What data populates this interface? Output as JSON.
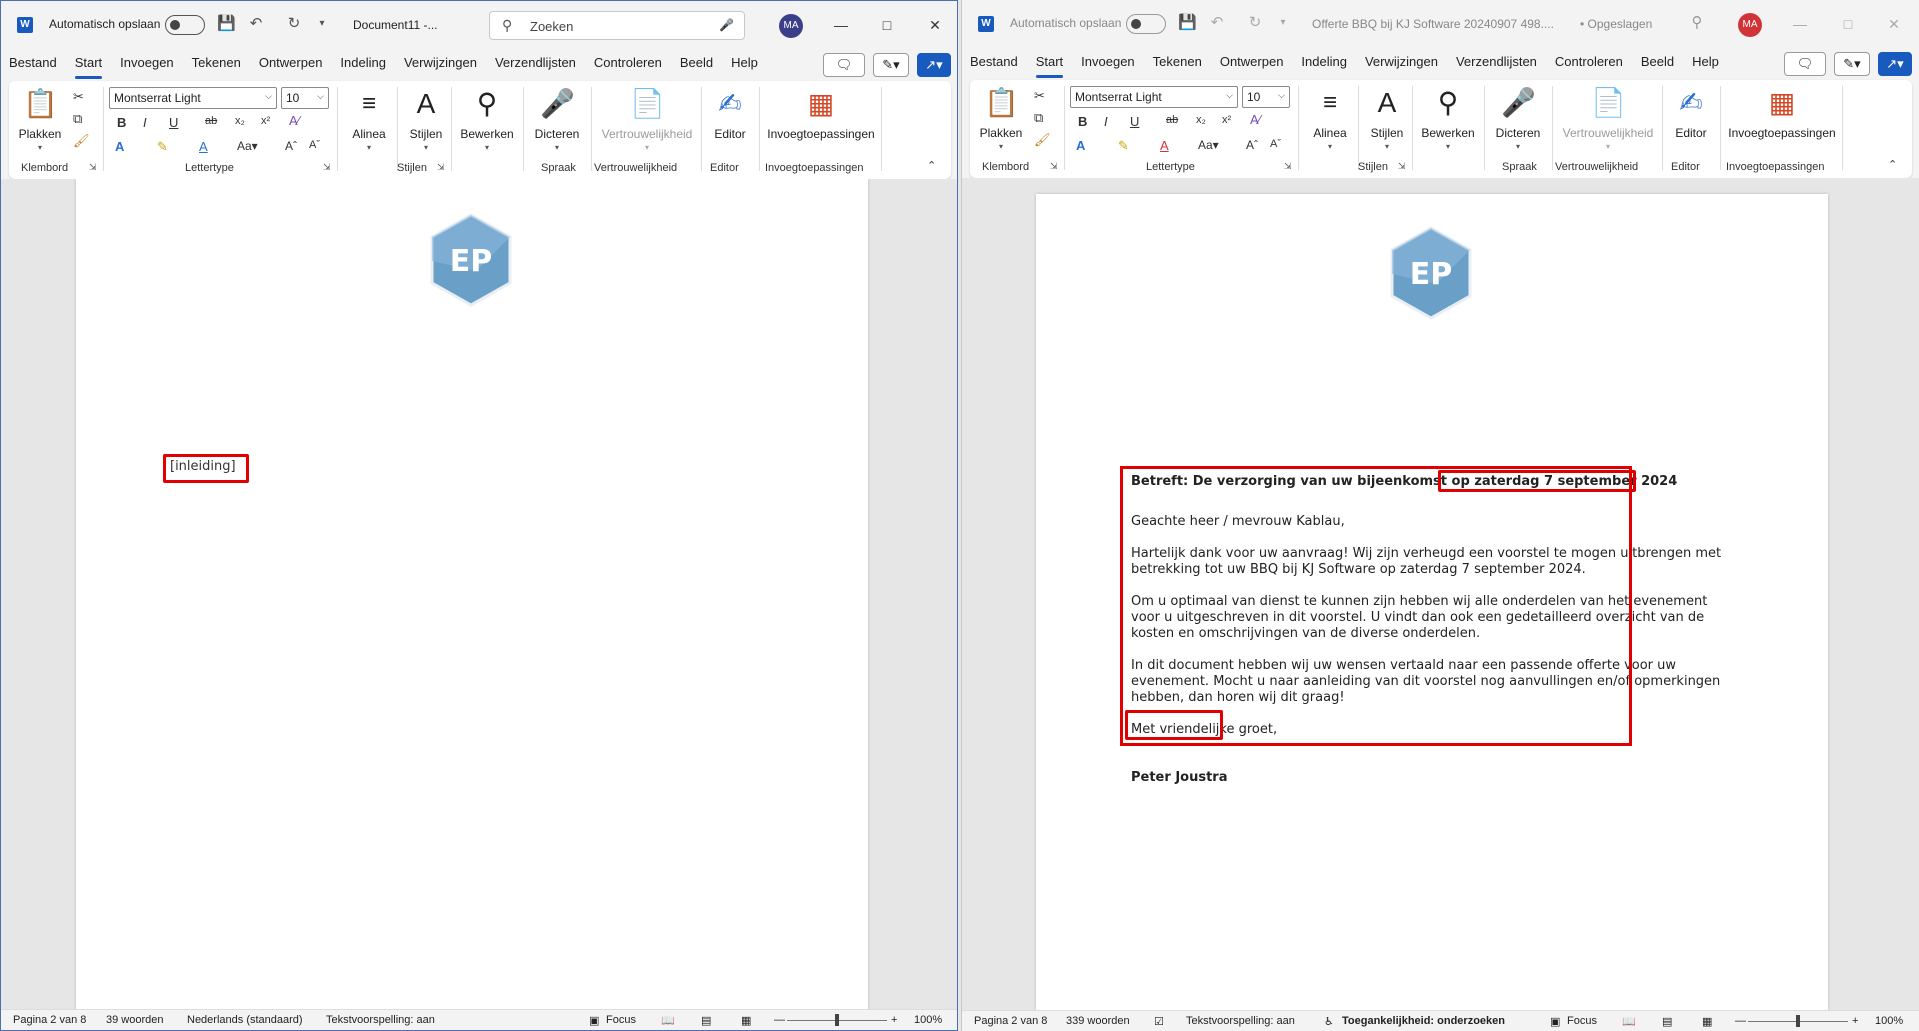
{
  "colors": {
    "word_blue": "#185abd",
    "highlight_red": "#e00000",
    "avatar_left": "#3b3f8a",
    "avatar_right": "#d13438",
    "logo_blue": "#6a9fc7"
  },
  "left": {
    "autosave_label": "Automatisch opslaan",
    "doc_title": "Document11  -...",
    "search_placeholder": "Zoeken",
    "avatar": "MA",
    "menu": [
      "Bestand",
      "Start",
      "Invoegen",
      "Tekenen",
      "Ontwerpen",
      "Indeling",
      "Verwijzingen",
      "Verzendlijsten",
      "Controleren",
      "Beeld",
      "Help"
    ],
    "ribbon": {
      "paste": "Plakken",
      "font_name": "Montserrat Light",
      "font_size": "10",
      "alinea": "Alinea",
      "stijlen": "Stijlen",
      "bewerken": "Bewerken",
      "dicteren": "Dicteren",
      "vertrouwelijkheid": "Vertrouwelijkheid",
      "editor": "Editor",
      "invoegtoepassingen": "Invoegtoepassingen",
      "group_labels": [
        "Klembord",
        "Lettertype",
        "Stijlen",
        "Spraak",
        "Vertrouwelijkheid",
        "Editor",
        "Invoegtoepassingen"
      ]
    },
    "logo_text": "EP",
    "placeholder_text": "[inleiding]",
    "status": {
      "page": "Pagina 2 van 8",
      "words": "39 woorden",
      "language": "Nederlands (standaard)",
      "predict": "Tekstvoorspelling: aan",
      "focus": "Focus",
      "zoom": "100%"
    }
  },
  "right": {
    "autosave_label": "Automatisch opslaan",
    "doc_title": "Offerte BBQ bij KJ Software 20240907 498....",
    "saved": "• Opgeslagen",
    "avatar": "MA",
    "menu": [
      "Bestand",
      "Start",
      "Invoegen",
      "Tekenen",
      "Ontwerpen",
      "Indeling",
      "Verwijzingen",
      "Verzendlijsten",
      "Controleren",
      "Beeld",
      "Help"
    ],
    "ribbon": {
      "paste": "Plakken",
      "font_name": "Montserrat Light",
      "font_size": "10",
      "alinea": "Alinea",
      "stijlen": "Stijlen",
      "bewerken": "Bewerken",
      "dicteren": "Dicteren",
      "vertrouwelijkheid": "Vertrouwelijkheid",
      "editor": "Editor",
      "invoegtoepassingen": "Invoegtoepassingen",
      "group_labels": [
        "Klembord",
        "Lettertype",
        "Stijlen",
        "Spraak",
        "Vertrouwelijkheid",
        "Editor",
        "Invoegtoepassingen"
      ]
    },
    "logo_text": "EP",
    "letter": {
      "subject_prefix": "Betreft: De verzorging van uw bijeenkomst op",
      "subject_date": "zaterdag 7 september 2024",
      "salutation": "Geachte heer / mevrouw Kablau,",
      "para1_l1": "Hartelijk dank voor uw aanvraag! Wij zijn verheugd een voorstel te mogen uitbrengen met",
      "para1_l2": "betrekking tot uw BBQ bij KJ Software op zaterdag 7 september 2024.",
      "para2_l1": "Om u optimaal van dienst te kunnen zijn hebben wij alle onderdelen van het evenement",
      "para2_l2": "voor u uitgeschreven in dit voorstel. U vindt dan ook een gedetailleerd overzicht van de",
      "para2_l3": "kosten en omschrijvingen van de diverse onderdelen.",
      "para3_l1": "In dit document hebben wij uw wensen vertaald naar een passende offerte voor uw",
      "para3_l2": "evenement. Mocht u naar aanleiding van dit voorstel nog aanvullingen en/of opmerkingen",
      "para3_l3": "hebben, dan horen wij dit graag!",
      "closing": "Met vriendelijke groet,",
      "signature": "Peter Joustra"
    },
    "status": {
      "page": "Pagina 2 van 8",
      "words": "339 woorden",
      "predict": "Tekstvoorspelling: aan",
      "accessibility": "Toegankelijkheid: onderzoeken",
      "focus": "Focus",
      "zoom": "100%"
    }
  }
}
